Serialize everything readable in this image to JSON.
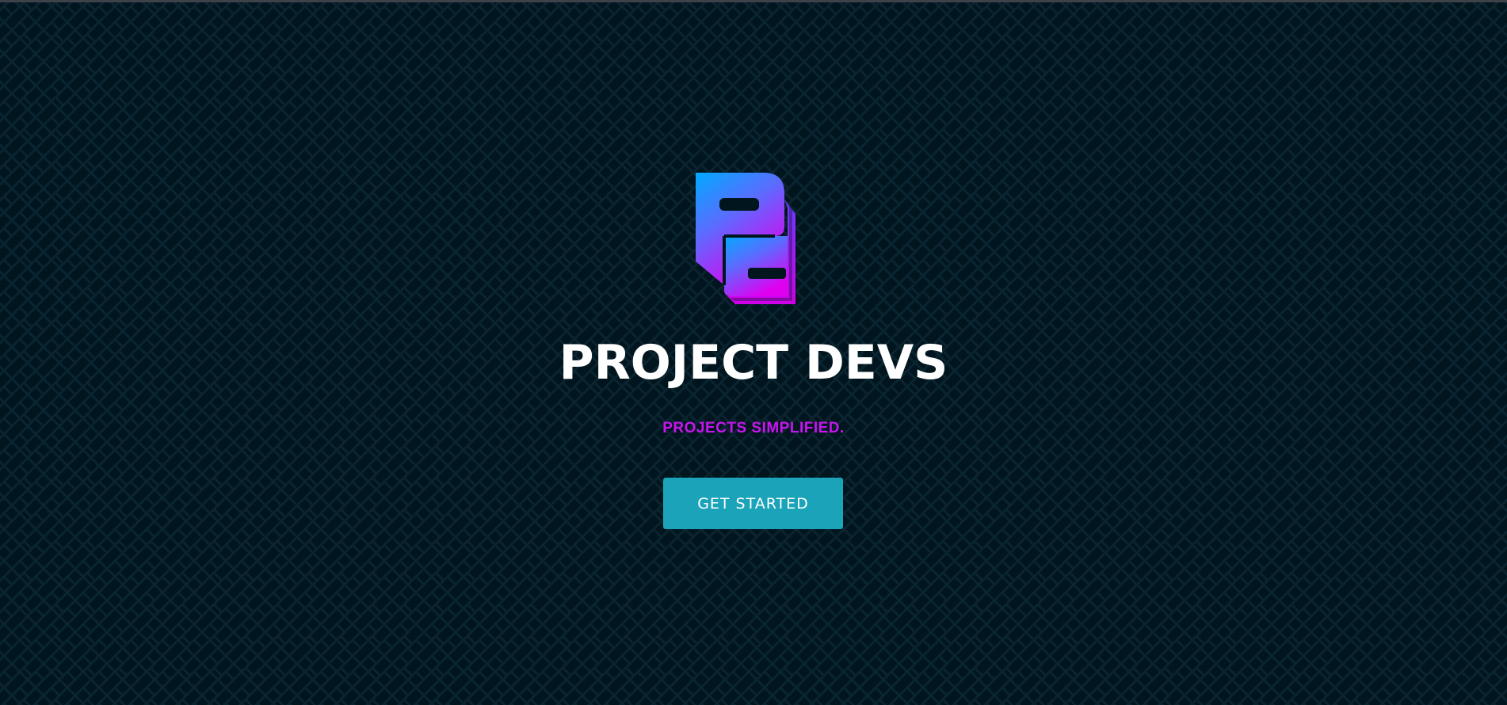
{
  "colors": {
    "background": "#01151f",
    "pattern_line": "#0a2430",
    "title": "#ffffff",
    "tagline": "#c914f0",
    "button_background": "#1aa3b9",
    "button_text": "#ffffff",
    "logo_gradient_start": "#00aaff",
    "logo_gradient_end": "#e000f0"
  },
  "hero": {
    "logo_icon": "project-devs-pd-logo",
    "title": "PROJECT DEVS",
    "tagline": "PROJECTS SIMPLIFIED.",
    "cta_label": "GET STARTED"
  }
}
